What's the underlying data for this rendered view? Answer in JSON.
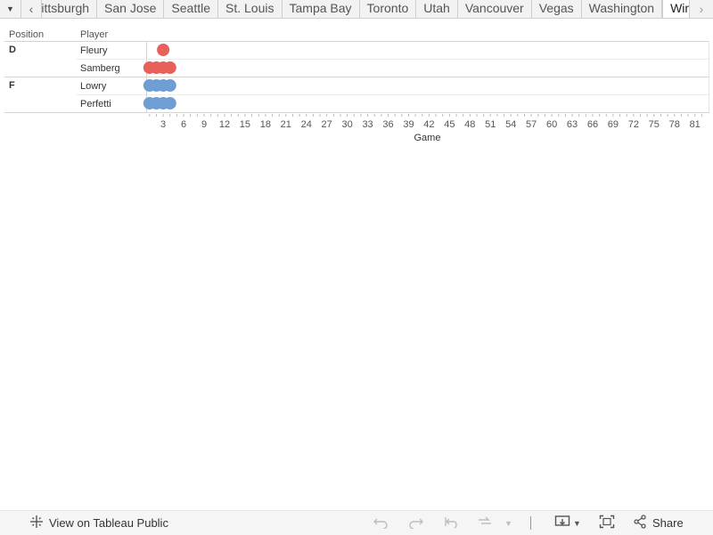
{
  "tabs": {
    "items": [
      "Pittsburgh",
      "San Jose",
      "Seattle",
      "St. Louis",
      "Tampa Bay",
      "Toronto",
      "Utah",
      "Vancouver",
      "Vegas",
      "Washington",
      "Winnipeg"
    ],
    "active": "Winnipeg",
    "dropdown_icon": "caret-down-icon",
    "prev_icon": "chevron-left-icon",
    "next_icon": "chevron-right-icon"
  },
  "table": {
    "position_header": "Position",
    "player_header": "Player",
    "groups": [
      {
        "position": "D",
        "players": [
          "Fleury",
          "Samberg"
        ]
      },
      {
        "position": "F",
        "players": [
          "Lowry",
          "Perfetti"
        ]
      }
    ]
  },
  "chart_data": {
    "type": "scatter",
    "xlabel": "Game",
    "xlim": [
      0.5,
      83
    ],
    "xticks": [
      3,
      6,
      9,
      12,
      15,
      18,
      21,
      24,
      27,
      30,
      33,
      36,
      39,
      42,
      45,
      48,
      51,
      54,
      57,
      60,
      63,
      66,
      69,
      72,
      75,
      78,
      81
    ],
    "colors": {
      "D": "#e8605a",
      "F": "#6e9ed4"
    },
    "series": [
      {
        "position": "D",
        "player": "Fleury",
        "games": [
          3
        ]
      },
      {
        "position": "D",
        "player": "Samberg",
        "games": [
          1,
          2,
          3,
          4
        ]
      },
      {
        "position": "F",
        "player": "Lowry",
        "games": [
          1,
          2,
          3,
          4
        ]
      },
      {
        "position": "F",
        "player": "Perfetti",
        "games": [
          1,
          2,
          3,
          4
        ]
      }
    ]
  },
  "toolbar": {
    "view_label": "View on Tableau Public",
    "share_label": "Share",
    "icons": [
      "tableau-icon",
      "undo-icon",
      "redo-icon",
      "revert-icon",
      "refresh-icon",
      "download-icon",
      "fullscreen-icon",
      "share-icon"
    ]
  }
}
